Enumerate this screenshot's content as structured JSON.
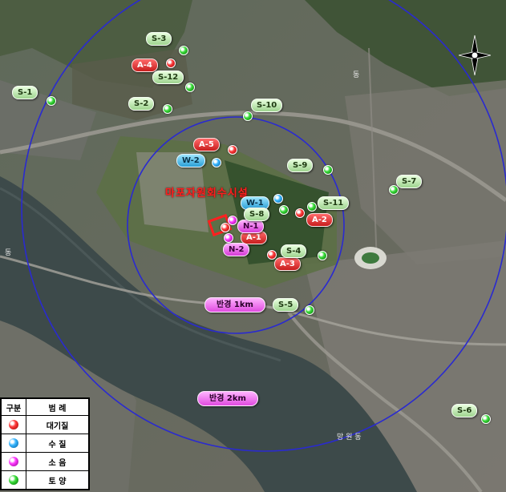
{
  "site_label": "마포자원회수시설",
  "radius_labels": {
    "r1": "반경 1km",
    "r2": "반경 2km"
  },
  "colors": {
    "air": "#e02020",
    "water": "#2aa0e0",
    "noise": "#d633d6",
    "soil": "#3bbb3b",
    "circle": "#2a2ad0"
  },
  "air_points": {
    "a1": "A-1",
    "a2": "A-2",
    "a3": "A-3",
    "a4": "A-4",
    "a5": "A-5"
  },
  "water_points": {
    "w1": "W-1",
    "w2": "W-2"
  },
  "noise_points": {
    "n1": "N-1",
    "n2": "N-2"
  },
  "soil_points": {
    "s1": "S-1",
    "s2": "S-2",
    "s3": "S-3",
    "s4": "S-4",
    "s5": "S-5",
    "s6": "S-6",
    "s7": "S-7",
    "s8": "S-8",
    "s9": "S-9",
    "s10": "S-10",
    "s11": "S-11",
    "s12": "S-12"
  },
  "legend": {
    "header_type": "구분",
    "header_label": "범 례",
    "rows": {
      "air": "대기질",
      "water": "수 질",
      "noise": "소 음",
      "soil": "토 양"
    }
  },
  "map_words": {
    "w1": "동",
    "w2": "동",
    "w3": "망 원 동"
  }
}
